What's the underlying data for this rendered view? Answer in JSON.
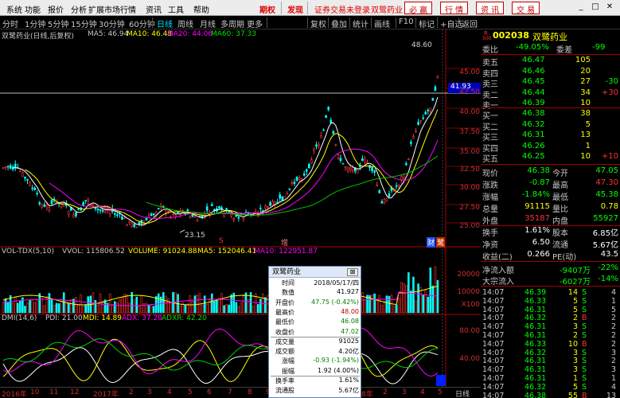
{
  "menu": {
    "items": [
      "系统",
      "功能",
      "报价",
      "分析",
      "扩展市场行情",
      "资讯",
      "工具",
      "帮助"
    ],
    "futures": "期权",
    "discover": "发现",
    "broker_link": "证券交易未登录",
    "stock_name": "双鹭药业",
    "icon_buttons": [
      "必",
      "行",
      "资",
      "交"
    ],
    "icon_buttons_full": [
      "必 赢",
      "行 情",
      "资 讯",
      "交 易"
    ]
  },
  "toolbar": {
    "periods": [
      "分时",
      "1分钟",
      "5分钟",
      "15分钟",
      "30分钟",
      "60分钟",
      "日线",
      "周线",
      "月线",
      "多周期",
      "更多"
    ],
    "active_period": "日线",
    "right_tools": [
      "复权",
      "叠加",
      "统计",
      "画线",
      "F10",
      "标记",
      "+自选",
      "返回"
    ]
  },
  "price_chart": {
    "title": "双鹭药业(日线,后复权)",
    "ma5_label": "MA5: 46.94",
    "ma10_label": "MA10: 46.48",
    "ma20_label": "MA20: 44.06",
    "ma60_label": "MA60: 37.33",
    "high_label": "48.60",
    "low_label": "23.15",
    "cursor_price": "41.93",
    "axis": [
      "45.00",
      "42.50",
      "40.00",
      "37.50",
      "35.00",
      "32.50",
      "30.00",
      "27.50",
      "25.00"
    ],
    "markers": [
      "S",
      "增"
    ],
    "tags": [
      "财",
      "鹭"
    ],
    "colors": {
      "ma5": "#ffffff",
      "ma10": "#ffff00",
      "ma20": "#ff00ff",
      "ma60": "#00c000",
      "up": "#ff3232",
      "down": "#00ffff"
    }
  },
  "volume_panel": {
    "title": "VOL-TDX(5,10)",
    "vvol": "VVOL: 115806.52",
    "volume": "VOLUME: 91024.88",
    "ma5": "MA5: 152046.41",
    "ma10": "MA10: 122951.87",
    "axis": [
      "20000",
      "10000",
      "X100"
    ]
  },
  "dmi_panel": {
    "title": "DMI(14,6)",
    "pdi": "PDI: 21.00",
    "mdi": "MDI: 14.89",
    "adx": "ADX: 37.28",
    "adxr": "ADXR: 42.20",
    "axis": [
      "80.00",
      "40.00"
    ]
  },
  "bottom": {
    "date_labels": [
      "2016年",
      "10",
      "11",
      "12",
      "2017年",
      "2",
      "3",
      "4",
      "5",
      "6",
      "7",
      "8",
      "9",
      "10",
      "11",
      "12",
      "2018年",
      "2",
      "3",
      "4",
      "5"
    ],
    "period": "日线"
  },
  "tooltip": {
    "title": "双鹭药业",
    "close": "⊠",
    "rows": [
      {
        "k": "时间",
        "v": "2018/05/17/四",
        "c": "#000000"
      },
      {
        "k": "数值",
        "v": "41.927",
        "c": "#000000"
      },
      {
        "k": "开盘价",
        "v": "47.75 (-0.42%)",
        "c": "#008000"
      },
      {
        "k": "最高价",
        "v": "48.00",
        "c": "#c00000"
      },
      {
        "k": "最低价",
        "v": "46.08",
        "c": "#008000"
      },
      {
        "k": "收盘价",
        "v": "47.02",
        "c": "#008000"
      },
      {
        "k": "成交量",
        "v": "91025",
        "c": "#000000"
      },
      {
        "k": "成交额",
        "v": "4.20亿",
        "c": "#000000"
      },
      {
        "k": "涨幅",
        "v": "-0.93 (-1.94%)",
        "c": "#008000"
      },
      {
        "k": "振幅",
        "v": "1.92 (4.00%)",
        "c": "#000000"
      },
      {
        "k": "换手率",
        "v": "1.61%",
        "c": "#000000"
      },
      {
        "k": "流通股",
        "v": "5.67亿",
        "c": "#000000"
      }
    ]
  },
  "quote": {
    "code": "002038",
    "name": "双鹭药业",
    "r_label": "R",
    "r_sub": "500",
    "weibi_label": "委比",
    "weibi_value": "-49.05%",
    "weicha_label": "委差",
    "weicha_value": "-99",
    "sells": [
      {
        "label": "卖五",
        "price": "46.47",
        "vol": "105",
        "chg": ""
      },
      {
        "label": "卖四",
        "price": "46.46",
        "vol": "20",
        "chg": ""
      },
      {
        "label": "卖三",
        "price": "46.45",
        "vol": "27",
        "chg": "-30"
      },
      {
        "label": "卖二",
        "price": "46.44",
        "vol": "34",
        "chg": "+30"
      },
      {
        "label": "卖一",
        "price": "46.39",
        "vol": "10",
        "chg": ""
      }
    ],
    "buys": [
      {
        "label": "买一",
        "price": "46.38",
        "vol": "38",
        "chg": ""
      },
      {
        "label": "买二",
        "price": "46.32",
        "vol": "5",
        "chg": ""
      },
      {
        "label": "买三",
        "price": "46.31",
        "vol": "13",
        "chg": ""
      },
      {
        "label": "买四",
        "price": "46.26",
        "vol": "1",
        "chg": ""
      },
      {
        "label": "买五",
        "price": "46.25",
        "vol": "10",
        "chg": "+10"
      }
    ],
    "stats": [
      {
        "l1": "现价",
        "v1": "46.38",
        "c1": "#00ff00",
        "l2": "今开",
        "v2": "47.05",
        "c2": "#00ff00"
      },
      {
        "l1": "涨跌",
        "v1": "-0.87",
        "c1": "#00ff00",
        "l2": "最高",
        "v2": "47.30",
        "c2": "#ff3232"
      },
      {
        "l1": "涨幅",
        "v1": "-1.84%",
        "c1": "#00ff00",
        "l2": "最低",
        "v2": "45.38",
        "c2": "#00ff00"
      },
      {
        "l1": "总量",
        "v1": "91115",
        "c1": "#ffff00",
        "l2": "量比",
        "v2": "0.78",
        "c2": "#ffff00"
      },
      {
        "l1": "外盘",
        "v1": "35187",
        "c1": "#ff3232",
        "l2": "内盘",
        "v2": "55927",
        "c2": "#00ff00"
      },
      {
        "l1": "换手",
        "v1": "1.61%",
        "c1": "#ffffff",
        "l2": "股本",
        "v2": "6.85亿",
        "c2": "#ffffff"
      },
      {
        "l1": "净资",
        "v1": "6.50",
        "c1": "#ffffff",
        "l2": "流通",
        "v2": "5.67亿",
        "c2": "#ffffff"
      },
      {
        "l1": "收益(二)",
        "v1": "0.266",
        "c1": "#ffffff",
        "l2": "PE(动)",
        "v2": "43.5",
        "c2": "#ffffff"
      }
    ],
    "flow": [
      {
        "label": "净流入额",
        "value": "-9407万",
        "pct": "-22%"
      },
      {
        "label": "大宗流入",
        "value": "-6027万",
        "pct": "-14%"
      }
    ],
    "ticks": [
      {
        "time": "14:07",
        "price": "46.39",
        "vol": "14",
        "bs": "S",
        "n": "4"
      },
      {
        "time": "14:07",
        "price": "46.33",
        "vol": "5",
        "bs": "S",
        "n": "1"
      },
      {
        "time": "14:07",
        "price": "46.31",
        "vol": "5",
        "bs": "S",
        "n": "5"
      },
      {
        "time": "14:07",
        "price": "46.32",
        "vol": "2",
        "bs": "B",
        "n": "2"
      },
      {
        "time": "14:07",
        "price": "46.31",
        "vol": "3",
        "bs": "S",
        "n": "2"
      },
      {
        "time": "14:07",
        "price": "46.31",
        "vol": "2",
        "bs": "S",
        "n": "2"
      },
      {
        "time": "14:07",
        "price": "46.33",
        "vol": "10",
        "bs": "B",
        "n": "2"
      },
      {
        "time": "14:07",
        "price": "46.32",
        "vol": "3",
        "bs": "S",
        "n": "3"
      },
      {
        "time": "14:07",
        "price": "46.31",
        "vol": "3",
        "bs": "S",
        "n": "2"
      },
      {
        "time": "14:07",
        "price": "46.31",
        "vol": "3",
        "bs": "S",
        "n": "3"
      },
      {
        "time": "14:07",
        "price": "46.31",
        "vol": "1",
        "bs": "S",
        "n": "1"
      },
      {
        "time": "14:07",
        "price": "46.32",
        "vol": "5",
        "bs": "S",
        "n": "4"
      },
      {
        "time": "14:07",
        "price": "46.38",
        "vol": "55",
        "bs": "B",
        "n": "13"
      }
    ]
  }
}
